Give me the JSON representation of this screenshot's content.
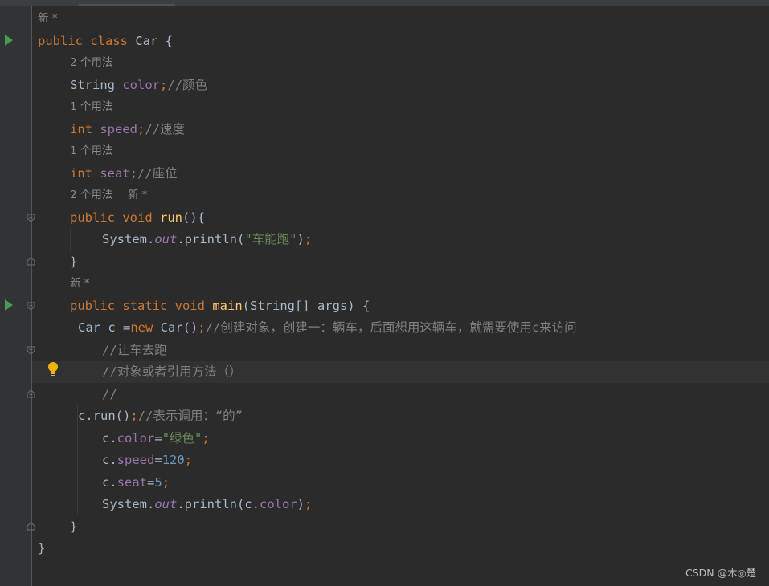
{
  "editor": {
    "hints": {
      "h1": "新 *",
      "h2": "2 个用法",
      "h3": "1 个用法",
      "h4": "1 个用法",
      "h5": "2 个用法",
      "h5b": "新 *",
      "h6": "新 *"
    },
    "code": {
      "l1_kw": "public class",
      "l1_rest": " Car {",
      "l2_type": "String",
      "l2_field": "color",
      "l2_semi": ";",
      "l2_comment": "//颜色",
      "l3_kw": "int",
      "l3_field": "speed",
      "l3_semi": ";",
      "l3_comment": "//速度",
      "l4_kw": "int",
      "l4_field": "seat",
      "l4_semi": ";",
      "l4_comment": "//座位",
      "l5_kw": "public void",
      "l5_fn": "run",
      "l5_rest": "(){",
      "l6_pre": "System.",
      "l6_out": "out",
      "l6_mid": ".println(",
      "l6_str": "\"车能跑\"",
      "l6_end": ")",
      "l6_semi": ";",
      "l7": "}",
      "l8_kw": "public static void",
      "l8_fn": "main",
      "l8_rest": "(String[] args) {",
      "l9_pre": "Car c =",
      "l9_kw": "new",
      "l9_mid": " Car()",
      "l9_semi": ";",
      "l9_comment": "//创建对象，创建一：辆车，后面想用这辆车，就需要使用c来访问",
      "l10_comment": "//让车去跑",
      "l11_comment": "//对象或者引用方法（）",
      "l12_comment": "//",
      "l13_pre": "c.run()",
      "l13_semi": ";",
      "l13_comment": "//表示调用：“的”",
      "l14_pre": "c.",
      "l14_field": "color",
      "l14_eq": "=",
      "l14_str": "\"绿色\"",
      "l14_semi": ";",
      "l15_pre": "c.",
      "l15_field": "speed",
      "l15_eq": "=",
      "l15_num": "120",
      "l15_semi": ";",
      "l16_pre": "c.",
      "l16_field": "seat",
      "l16_eq": "=",
      "l16_num": "5",
      "l16_semi": ";",
      "l17_pre": "System.",
      "l17_out": "out",
      "l17_mid": ".println(c.",
      "l17_field": "color",
      "l17_end": ")",
      "l17_semi": ";",
      "l18": "}",
      "l19": "}"
    },
    "icons": {
      "run": "run-gutter-icon",
      "fold": "fold-marker-icon",
      "bulb": "intention-bulb-icon"
    }
  },
  "colors": {
    "background": "#2b2b2b",
    "keyword": "#cc7832",
    "field": "#9876aa",
    "comment": "#808080",
    "string": "#6a8759",
    "number": "#6897bb",
    "method": "#ffc66d"
  },
  "watermark": "CSDN @木◎楚"
}
